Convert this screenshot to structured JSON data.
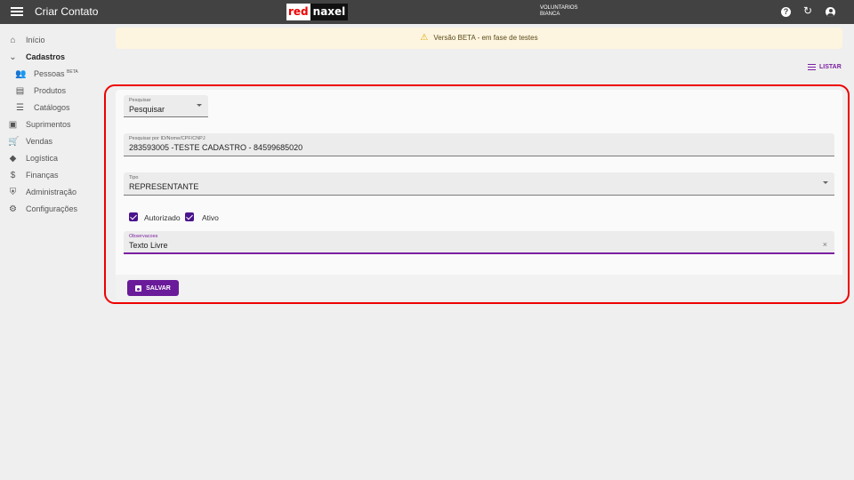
{
  "header": {
    "title": "Criar Contato",
    "logo_part1": "red",
    "logo_part2": "naxel",
    "user_line1": "VOLUNTARIOS",
    "user_line2": "BIANCA",
    "icons": [
      "menu-icon",
      "help-icon",
      "refresh-icon",
      "account-icon"
    ]
  },
  "sidebar": {
    "items": [
      {
        "label": "Início",
        "icon": "home-icon"
      },
      {
        "label": "Cadastros",
        "icon": "chevron-down-icon"
      },
      {
        "label": "Pessoas",
        "badge": "BETA",
        "icon": "people-icon"
      },
      {
        "label": "Produtos",
        "icon": "product-icon"
      },
      {
        "label": "Catálogos",
        "icon": "list-icon"
      },
      {
        "label": "Suprimentos",
        "icon": "briefcase-icon"
      },
      {
        "label": "Vendas",
        "icon": "cart-icon"
      },
      {
        "label": "Logística",
        "icon": "directions-icon"
      },
      {
        "label": "Finanças",
        "icon": "dollar-icon"
      },
      {
        "label": "Administração",
        "icon": "shield-icon"
      },
      {
        "label": "Configurações",
        "icon": "gear-icon"
      }
    ]
  },
  "banner": {
    "text": "Versão BETA - em fase de testes"
  },
  "actions": {
    "listar": "LISTAR"
  },
  "form": {
    "pesquisar_label": "Pesquisar",
    "pesquisar_value": "Pesquisar",
    "search_label": "Pesquisar por ID/Nome/CPF/CNPJ",
    "search_value": "283593005 -TESTE CADASTRO - 84599685020",
    "tipo_label": "Tipo",
    "tipo_value": "REPRESENTANTE",
    "autorizado_label": "Autorizado",
    "ativo_label": "Ativo",
    "obs_label": "Observacoes",
    "obs_value": "Texto Livre",
    "save_label": "SALVAR"
  },
  "colors": {
    "accent": "#6a1b9a",
    "topbar": "#424242",
    "highlight": "#e00000"
  }
}
